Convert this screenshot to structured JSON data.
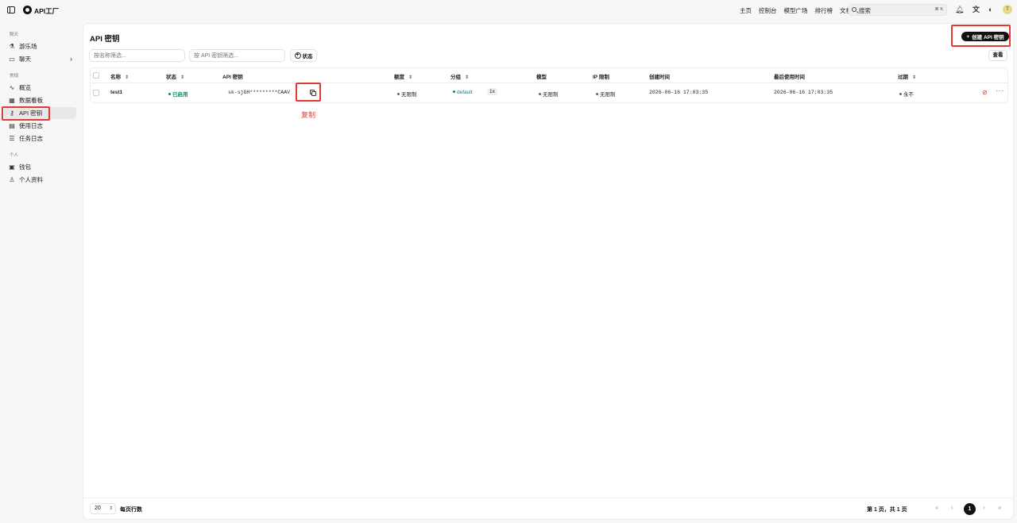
{
  "app": {
    "brand": "API工厂"
  },
  "topnav": {
    "items": [
      "主页",
      "控制台",
      "模型广场",
      "排行榜",
      "文档"
    ],
    "search_placeholder": "搜索",
    "search_shortcut": "⌘ K",
    "avatar_initial": "T"
  },
  "sidebar": {
    "sections": [
      {
        "label": "聊天",
        "items": [
          {
            "label": "游乐场",
            "icon": "flask-icon"
          },
          {
            "label": "聊天",
            "icon": "chat-icon"
          }
        ]
      },
      {
        "label": "常规",
        "items": [
          {
            "label": "概览",
            "icon": "activity-icon"
          },
          {
            "label": "数据看板",
            "icon": "dashboard-icon"
          },
          {
            "label": "API 密钥",
            "icon": "key-icon"
          },
          {
            "label": "使用日志",
            "icon": "log-icon"
          },
          {
            "label": "任务日志",
            "icon": "tasks-icon"
          }
        ]
      },
      {
        "label": "个人",
        "items": [
          {
            "label": "钱包",
            "icon": "wallet-icon"
          },
          {
            "label": "个人资料",
            "icon": "user-icon"
          }
        ]
      }
    ],
    "active": "API 密钥"
  },
  "page": {
    "title": "API 密钥",
    "create_button": "创建 API 密钥",
    "filter_name_placeholder": "按名称筛选...",
    "filter_key_placeholder": "按 API 密钥筛选...",
    "status_filter": "状态",
    "view_button": "查看"
  },
  "table": {
    "columns": [
      "名称",
      "状态",
      "API 密钥",
      "额度",
      "分组",
      "模型",
      "IP 限制",
      "创建时间",
      "最后使用时间",
      "过期"
    ],
    "rows": [
      {
        "name": "test1",
        "status": "已启用",
        "key": "sk-sjGH*********CAAV",
        "quota": "无限制",
        "group": "default",
        "ratio": "1x",
        "models": "无限制",
        "ip_limit": "无限制",
        "created": "2026-06-16 17:03:35",
        "last_used": "2026-06-16 17:03:35",
        "expiry": "永不"
      }
    ]
  },
  "footer": {
    "page_size": "20",
    "page_size_label": "每页行数",
    "page_info": "第 1 页，共 1 页",
    "current_page": "1"
  },
  "annotation": {
    "label": "复制",
    "color": "#e53935"
  }
}
